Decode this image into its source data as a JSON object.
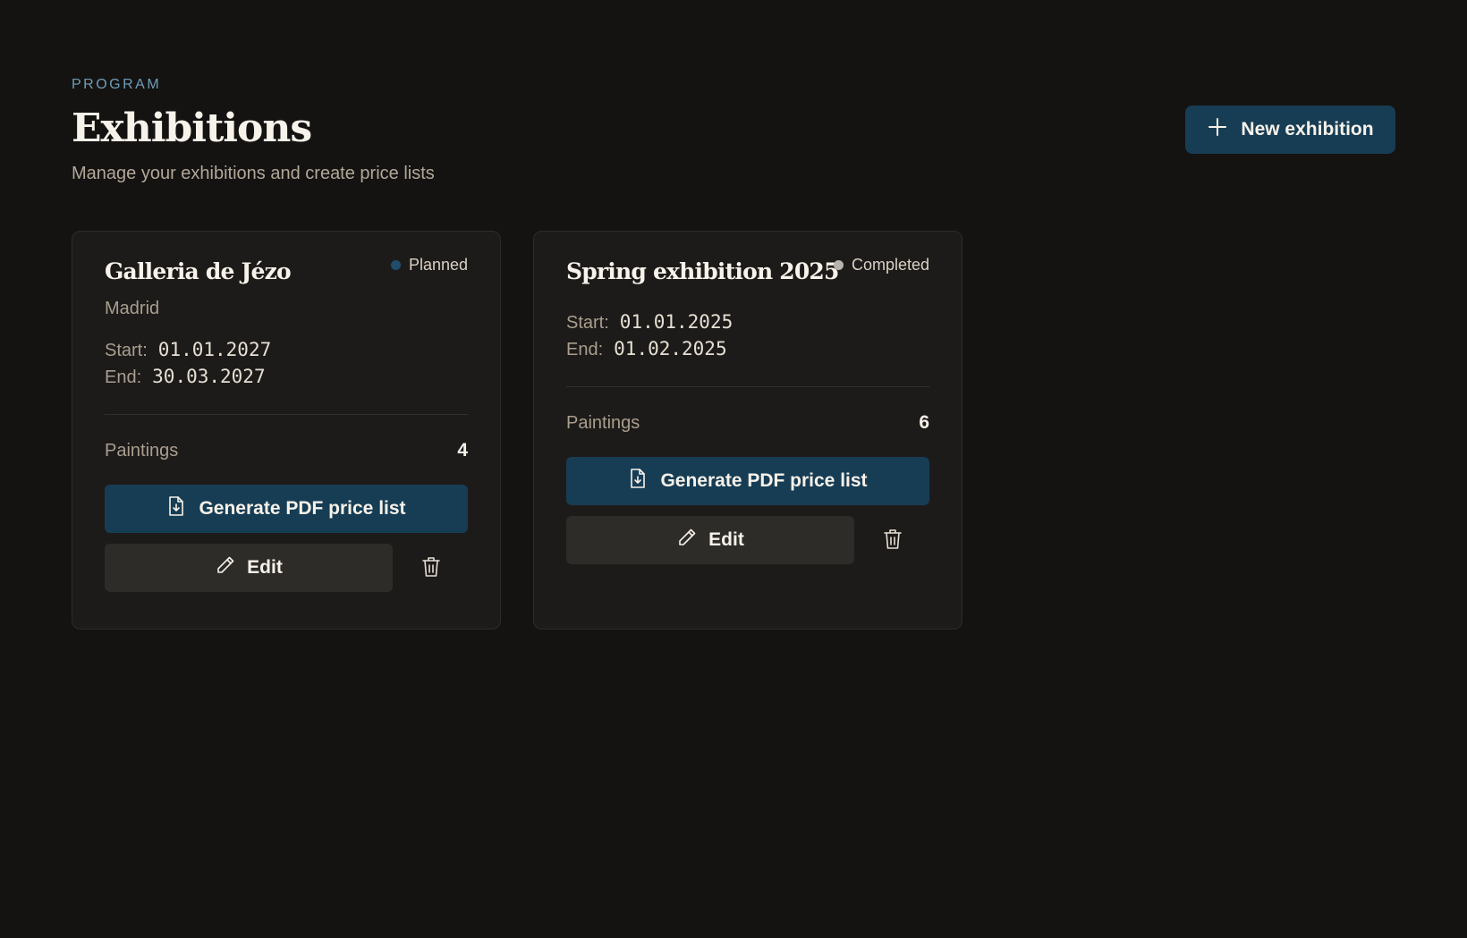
{
  "header": {
    "eyebrow": "PROGRAM",
    "title": "Exhibitions",
    "subtitle": "Manage your exhibitions and create price lists",
    "new_button_label": "New exhibition"
  },
  "colors": {
    "accent": "#173d55",
    "planned": "#1f4d6b",
    "completed": "#b8b4ad",
    "background": "#141312",
    "card": "#1d1b19"
  },
  "exhibitions": [
    {
      "title": "Galleria de Jézo",
      "status": "Planned",
      "location": "Madrid",
      "start_label": "Start:",
      "start": "01.01.2027",
      "end_label": "End:",
      "end": "30.03.2027",
      "paintings_label": "Paintings",
      "paintings": "4",
      "pdf_label": "Generate PDF price list",
      "edit_label": "Edit"
    },
    {
      "title": "Spring exhibition 2025",
      "status": "Completed",
      "start_label": "Start:",
      "start": "01.01.2025",
      "end_label": "End:",
      "end": "01.02.2025",
      "paintings_label": "Paintings",
      "paintings": "6",
      "pdf_label": "Generate PDF price list",
      "edit_label": "Edit"
    }
  ]
}
